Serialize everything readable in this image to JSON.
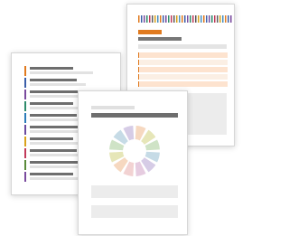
{
  "documents": {
    "back": {
      "stripe_colors": [
        "#e07a1f",
        "#3b5ea8",
        "#7a4a9e",
        "#2e8b6b",
        "#c23a5a",
        "#5a5a5a",
        "#d9a21b",
        "#4a90c2"
      ],
      "accent": "#e07a1f",
      "highlight_fill": "#fde3cf",
      "table_rows": 5
    },
    "left": {
      "marker_colors": [
        "#e07a1f",
        "#3b5ea8",
        "#7a4a9e",
        "#2e8b6b",
        "#2b7bb9",
        "#6a4a9e",
        "#d9a21b",
        "#c23a5a",
        "#5a8a3a",
        "#7a4a9e"
      ]
    },
    "front": {
      "wheel_colors": [
        "#f6d8c0",
        "#e6e6b8",
        "#cfe3c6",
        "#c6dbe6",
        "#d6cce6",
        "#e6cce0",
        "#f2d2d2",
        "#f6d8c0",
        "#e6e6b8",
        "#cfe3c6",
        "#c6dbe6",
        "#d6cce6"
      ]
    }
  }
}
